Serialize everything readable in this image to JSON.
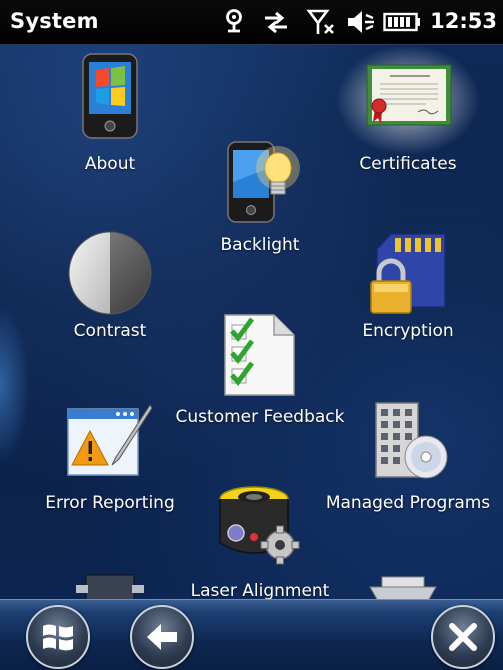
{
  "titlebar": {
    "title": "System",
    "clock": "12:53",
    "status_icons": [
      "gps-icon",
      "data-transfer-icon",
      "signal-off-icon",
      "volume-muted-icon",
      "battery-icon"
    ]
  },
  "items": {
    "about": {
      "label": "About",
      "icon": "phone-windows-icon"
    },
    "certificates": {
      "label": "Certificates",
      "icon": "certificate-icon"
    },
    "backlight": {
      "label": "Backlight",
      "icon": "phone-bulb-icon"
    },
    "contrast": {
      "label": "Contrast",
      "icon": "contrast-circle-icon"
    },
    "encryption": {
      "label": "Encryption",
      "icon": "sd-card-lock-icon"
    },
    "customer_feedback": {
      "label": "Customer Feedback",
      "icon": "checklist-icon"
    },
    "error_reporting": {
      "label": "Error Reporting",
      "icon": "warning-window-icon"
    },
    "managed_programs": {
      "label": "Managed Programs",
      "icon": "building-disc-icon"
    },
    "laser_alignment": {
      "label": "Laser Alignment",
      "icon": "laser-gear-icon"
    }
  },
  "softkeys": {
    "start": {
      "icon": "windows-start-icon"
    },
    "back": {
      "icon": "back-arrow-icon"
    },
    "close": {
      "icon": "close-icon"
    }
  },
  "colors": {
    "background": "#0b2047",
    "titlebar": "#000000",
    "accent": "#1d3e72"
  }
}
